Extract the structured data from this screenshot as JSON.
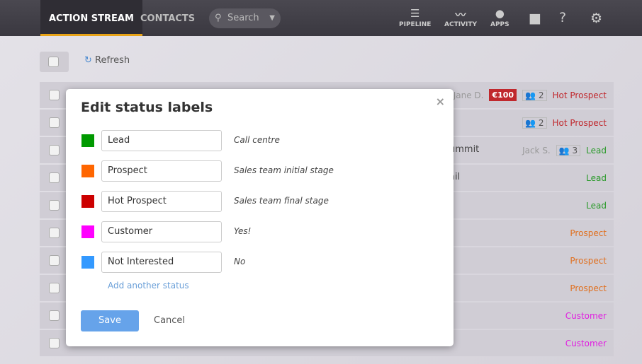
{
  "topbar": {
    "tabs": [
      {
        "label": "ACTION STREAM",
        "active": true
      },
      {
        "label": "CONTACTS",
        "active": false
      }
    ],
    "search_placeholder": "Search",
    "nav": [
      {
        "label": "PIPELINE",
        "icon": "funnel-icon"
      },
      {
        "label": "ACTIVITY",
        "icon": "pulse-icon"
      },
      {
        "label": "APPS",
        "icon": "apps-icon"
      }
    ],
    "icons": [
      "chat-icon",
      "help-icon",
      "gear-icon"
    ]
  },
  "toolbar": {
    "refresh_label": "Refresh"
  },
  "rows": [
    {
      "owner": "Jane D.",
      "amount": "€100",
      "people": "2",
      "status": "Hot Prospect",
      "status_color": "#c0282d",
      "text": ""
    },
    {
      "owner": "",
      "amount": "",
      "people": "2",
      "status": "Hot Prospect",
      "status_color": "#c0282d",
      "text": ""
    },
    {
      "owner": "Jack S.",
      "amount": "",
      "people": "3",
      "status": "Lead",
      "status_color": "#2a9a2a",
      "text": "ummit"
    },
    {
      "owner": "",
      "amount": "",
      "people": "",
      "status": "Lead",
      "status_color": "#2a9a2a",
      "text": "ail"
    },
    {
      "owner": "",
      "amount": "",
      "people": "",
      "status": "Lead",
      "status_color": "#2a9a2a",
      "text": ""
    },
    {
      "owner": "",
      "amount": "",
      "people": "",
      "status": "Prospect",
      "status_color": "#e07020",
      "text": ""
    },
    {
      "owner": "",
      "amount": "",
      "people": "",
      "status": "Prospect",
      "status_color": "#e07020",
      "text": ""
    },
    {
      "owner": "",
      "amount": "",
      "people": "",
      "status": "Prospect",
      "status_color": "#e07020",
      "text": ""
    },
    {
      "owner": "",
      "amount": "",
      "people": "",
      "status": "Customer",
      "status_color": "#e020e0",
      "text": ""
    },
    {
      "owner": "",
      "amount": "",
      "people": "",
      "status": "Customer",
      "status_color": "#e020e0",
      "text": ""
    }
  ],
  "modal": {
    "title": "Edit status labels",
    "close": "×",
    "statuses": [
      {
        "name": "Lead",
        "description": "Call centre",
        "color": "#009900"
      },
      {
        "name": "Prospect",
        "description": "Sales team initial stage",
        "color": "#ff6600"
      },
      {
        "name": "Hot Prospect",
        "description": "Sales team final stage",
        "color": "#cc0000"
      },
      {
        "name": "Customer",
        "description": "Yes!",
        "color": "#ff00ff"
      },
      {
        "name": "Not Interested",
        "description": "No",
        "color": "#3399ff"
      }
    ],
    "add_label": "Add another status",
    "save_label": "Save",
    "cancel_label": "Cancel"
  }
}
